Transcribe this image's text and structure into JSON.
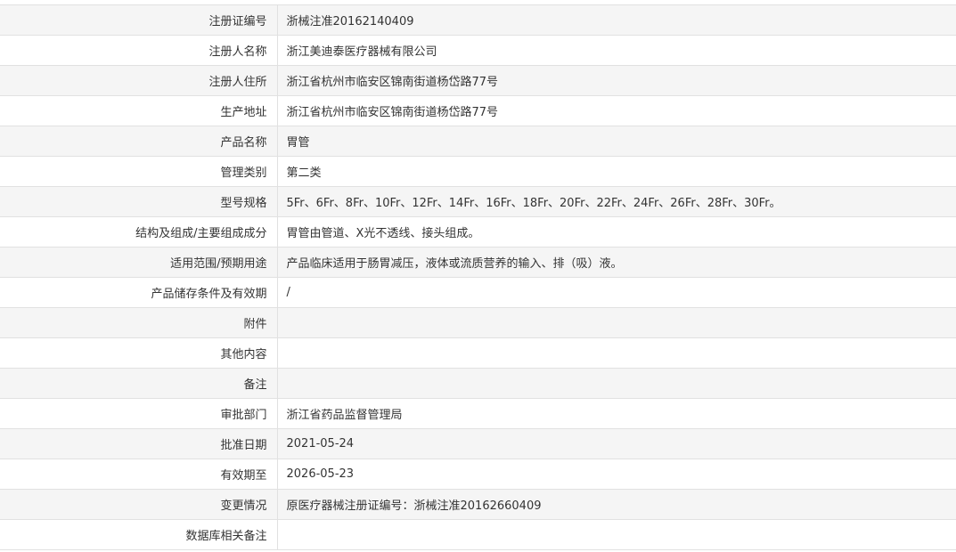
{
  "rows": [
    {
      "label": "注册证编号",
      "value": "浙械注准20162140409"
    },
    {
      "label": "注册人名称",
      "value": "浙江美迪泰医疗器械有限公司"
    },
    {
      "label": "注册人住所",
      "value": "浙江省杭州市临安区锦南街道杨岱路77号"
    },
    {
      "label": "生产地址",
      "value": "浙江省杭州市临安区锦南街道杨岱路77号"
    },
    {
      "label": "产品名称",
      "value": "胃管"
    },
    {
      "label": "管理类别",
      "value": "第二类"
    },
    {
      "label": "型号规格",
      "value": "5Fr、6Fr、8Fr、10Fr、12Fr、14Fr、16Fr、18Fr、20Fr、22Fr、24Fr、26Fr、28Fr、30Fr。"
    },
    {
      "label": "结构及组成/主要组成成分",
      "value": "胃管由管道、X光不透线、接头组成。"
    },
    {
      "label": "适用范围/预期用途",
      "value": "产品临床适用于肠胃减压，液体或流质营养的输入、排（吸）液。"
    },
    {
      "label": "产品储存条件及有效期",
      "value": "/"
    },
    {
      "label": "附件",
      "value": ""
    },
    {
      "label": "其他内容",
      "value": ""
    },
    {
      "label": "备注",
      "value": ""
    },
    {
      "label": "审批部门",
      "value": "浙江省药品监督管理局"
    },
    {
      "label": "批准日期",
      "value": "2021-05-24"
    },
    {
      "label": "有效期至",
      "value": "2026-05-23"
    },
    {
      "label": "变更情况",
      "value": "原医疗器械注册证编号：浙械注准20162660409"
    },
    {
      "label": "数据库相关备注",
      "value": ""
    }
  ]
}
